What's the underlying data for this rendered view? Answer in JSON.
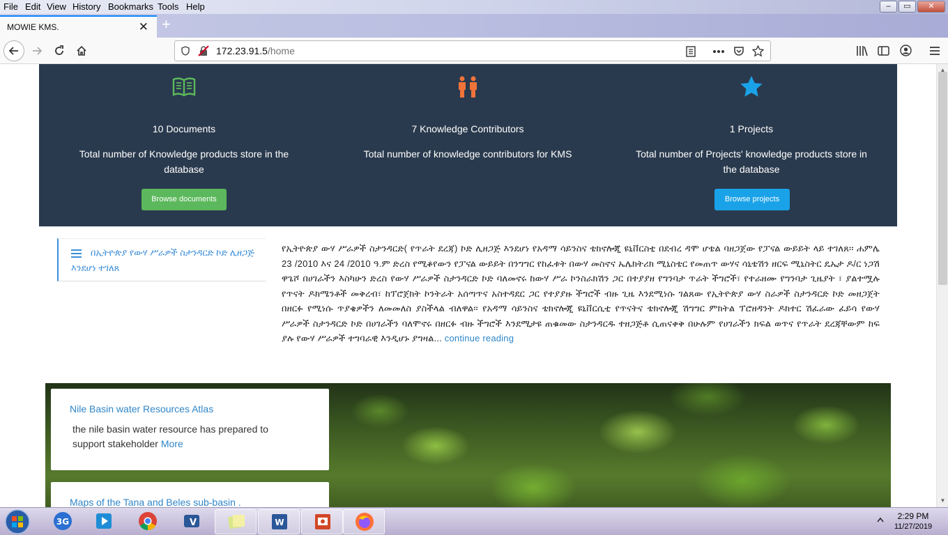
{
  "menubar": {
    "items": [
      "File",
      "Edit",
      "View",
      "History",
      "Bookmarks",
      "Tools",
      "Help"
    ]
  },
  "window": {
    "controls": {
      "minimize": "–",
      "maximize": "▭",
      "close": "✕"
    }
  },
  "tabs": [
    {
      "title": "MOWIE KMS.",
      "close": "✕"
    }
  ],
  "new_tab": "+",
  "address": {
    "host": "172.23.91.5",
    "path": "/home"
  },
  "stats": [
    {
      "count": "10 Documents",
      "description": "Total number of Knowledge products store in the database",
      "button": "Browse documents",
      "icon": "book-icon",
      "color": "#5cb85c"
    },
    {
      "count": "7 Knowledge Contributors",
      "description": "Total number of knowledge contributors for KMS",
      "icon": "people-icon",
      "color": "#f0733a"
    },
    {
      "count": "1 Projects",
      "description": "Total number of Projects' knowledge products store in the database",
      "button": "Browse projects",
      "icon": "star-icon",
      "color": "#1aa2e8"
    }
  ],
  "news": {
    "title": "በኢትዮጵያ የውሃ ሥራዎች ስታንዳርድ ኮድ ሊዘጋጅ እንደሆነ ተገለጸ",
    "body": "የኢትዮጵያ ውሃ ሥራዎች ስታንዳርድ( የጥራት ደረጃ) ኮድ ሊዘጋጅ እንደሆነ የአዳማ ሳይንስና ቴክኖሎጂ ዩኒቨርስቲ በደብረ ዳሞ ሆቴል ባዘጋጀው የፓናል ውይይት ላይ ተገለጸ፡፡ ሐምሌ 23 /2010 እና 24 /2010 ዓ.ም ድረስ የሚቆየውን የፓናል ውይይት በንግግር የከፈቱት በውሃ መስኖና ኤሌክትሪክ ሚኒስቴር የመጠጥ ውሃና ሳኒቴሽን ዘርፍ ሚኒስትር ዴኤታ ዶ/ር ነጋሽ ዋጌሾ በሀገራችን እስካሁን ድረስ የውሃ ሥራዎች ስታንዳርድ ኮድ ባለመኖሩ ከውሃ ሥራ ኮንስራክሽን ጋር በተያያዘ የግንባታ ጥራት ችግሮች፣ የተራዘሙ የግንባታ ጊዜያት ፣ ያልተሟሉ የጥናት ዶክሜንቶች መቅረብ፣ ከፕሮጀክት ኮንትራት አሰጣጥና አስተዳደር ጋር የተያያዙ ችግሮች ብዙ ጊዜ እንደሚነሱ ገልጸው የኢትዮጵያ ውሃ ስራዎች ስታንዳርድ ኮድ መዘጋጀት በዘርፉ የሚነሱ ጥያቄዎችን ለመመለስ ያስችላል ብለዋል፡፡ የአዳማ ሳይንስና ቴክኖሎጂ ዩኒቨርሲቲ የጥናትና ቴክኖሎጂ ሽግግር ምክትል ፕሮዘዳንት ዶክተር ሽፈራው ፈይሳ የውሃ ሥራዎች ስታንዳርድ ኮድ በሀገራችን ባለሞኖሩ በዘርፉ ብዙ ችግሮች እንደሚታዩ ጠቁመው ስታንዳርዱ ተዘጋጅቶ ሲጠናቀቅ በሁሉም የሀገራችን ክፍል ወጥና የጥራት ደረጃቸውም ከፍ ያሉ የውሃ ሥራዎች ተግባራዊ እንዲሆኑ ያግዛል...",
    "more": " continue reading"
  },
  "cards": [
    {
      "title": "Nile Basin water Resources Atlas",
      "text": "the nile basin water resource has prepared to support stakeholder",
      "more": "More"
    },
    {
      "title": "Maps of the Tana and Beles sub-basin ."
    }
  ],
  "taskbar": {
    "time": "2:29 PM",
    "date": "11/27/2019"
  }
}
